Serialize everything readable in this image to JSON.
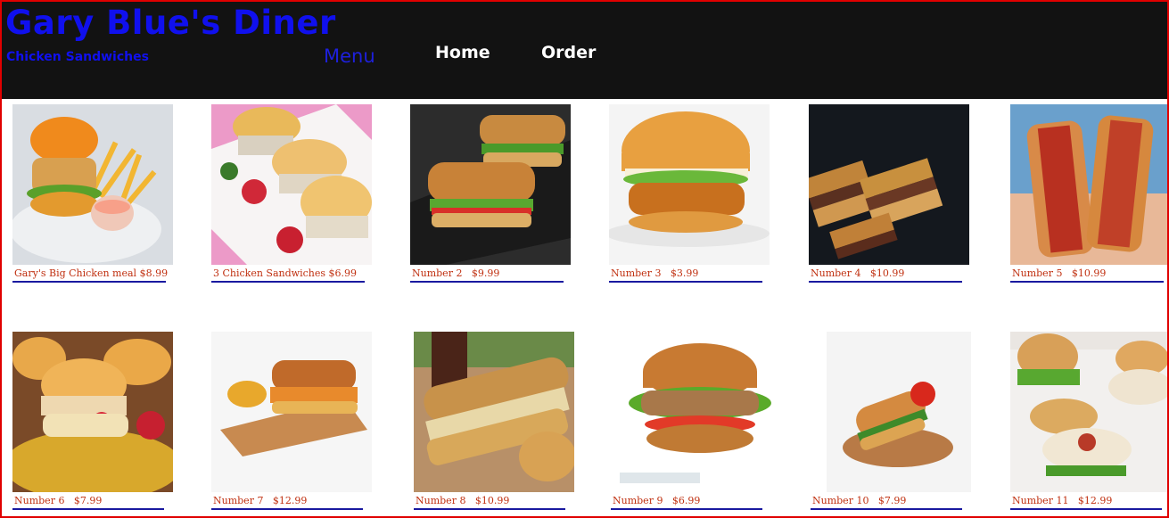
{
  "header": {
    "title": "Gary Blue's Diner",
    "subtitle": "Chicken Sandwiches",
    "nav": {
      "menu": "Menu",
      "home": "Home",
      "order": "Order"
    }
  },
  "colors": {
    "header_bg": "#121212",
    "title": "#1010ee",
    "border": "#e00000",
    "caption": "#c03010",
    "underline": "#1a1aa0"
  },
  "menu_items": [
    {
      "caption": "Gary's Big Chicken meal $8.99",
      "image": "chicken-meal-with-fries-photo"
    },
    {
      "caption": "3 Chicken Sandwiches $6.99",
      "image": "three-chicken-sliders-photo"
    },
    {
      "caption": "Number 2   $9.99",
      "image": "grilled-sub-sandwiches-photo"
    },
    {
      "caption": "Number 3   $3.99",
      "image": "crispy-chicken-burger-photo"
    },
    {
      "caption": "Number 4   $10.99",
      "image": "toasted-sandwich-stack-photo"
    },
    {
      "caption": "Number 5   $10.99",
      "image": "hand-held-sandwich-halves-photo"
    },
    {
      "caption": "Number 6   $7.99",
      "image": "chicken-sliders-plate-photo"
    },
    {
      "caption": "Number 7   $12.99",
      "image": "chicken-hoagie-board-photo"
    },
    {
      "caption": "Number 8   $10.99",
      "image": "long-sub-sandwich-photo"
    },
    {
      "caption": "Number 9   $6.99",
      "image": "grilled-chicken-burger-photo"
    },
    {
      "caption": "Number 10   $7.99",
      "image": "chicken-roll-plate-photo"
    },
    {
      "caption": "Number 11   $12.99",
      "image": "chicken-burgers-tray-photo"
    }
  ]
}
